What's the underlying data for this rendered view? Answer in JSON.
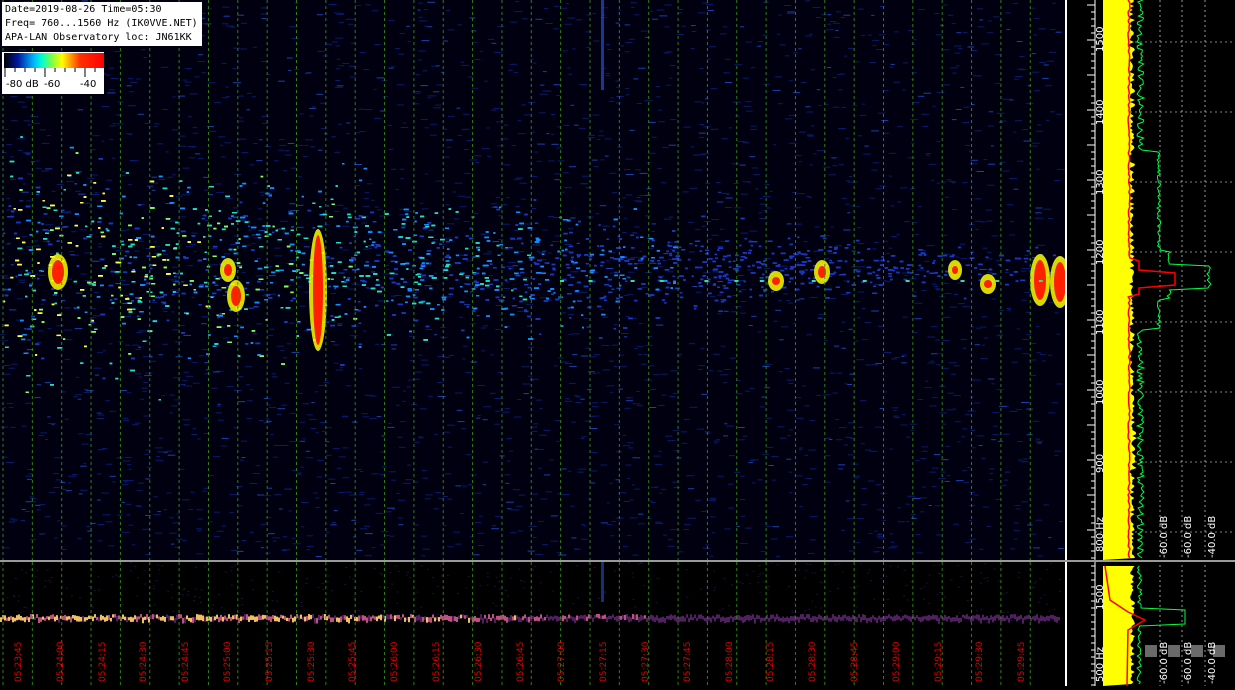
{
  "header": {
    "line1": "Date=2019-08-26 Time=05:30",
    "line2": "Freq= 760...1560 Hz (IK0VVE.NET)",
    "line3": "APA-LAN Observatory loc: JN61KK"
  },
  "colorbar": {
    "labels": [
      "-80 dB",
      "-60",
      "-40"
    ]
  },
  "main_freq_axis": {
    "ticks": [
      "1500",
      "1400",
      "1300",
      "1200",
      "1100",
      "1000",
      "900",
      "800 Hz"
    ],
    "values": [
      1500,
      1400,
      1300,
      1200,
      1100,
      1000,
      900,
      800
    ],
    "range_hz": [
      760,
      1560
    ]
  },
  "sub_freq_axis": {
    "ticks": [
      "1500",
      "500 Hz"
    ]
  },
  "main_db_axis": {
    "ticks": [
      "-60.0 dB",
      "-60.0 dB",
      "-40.0 dB"
    ]
  },
  "sub_db_axis": {
    "ticks": [
      "-60.0 dB",
      "-60.0 dB",
      "-40.0 dB"
    ]
  },
  "time_axis": {
    "labels": [
      "05:23:45",
      "05:24:00",
      "05:24:15",
      "05:24:30",
      "05:24:45",
      "05:25:00",
      "05:25:15",
      "05:25:30",
      "05:25:45",
      "05:26:00",
      "05:26:15",
      "05:26:30",
      "05:26:45",
      "05:27:00",
      "05:27:15",
      "05:27:30",
      "05:27:45",
      "05:28:00",
      "05:28:15",
      "05:28:30",
      "05:28:45",
      "05:29:00",
      "05:29:15",
      "05:29:30",
      "05:29:45"
    ]
  },
  "colors": {
    "grid_vertical": "#3a8a20",
    "time_label": "#e00000",
    "spectrum_avg": "#ff0000",
    "spectrum_max": "#00ff40",
    "spectrum_min": "#ffff00"
  }
}
